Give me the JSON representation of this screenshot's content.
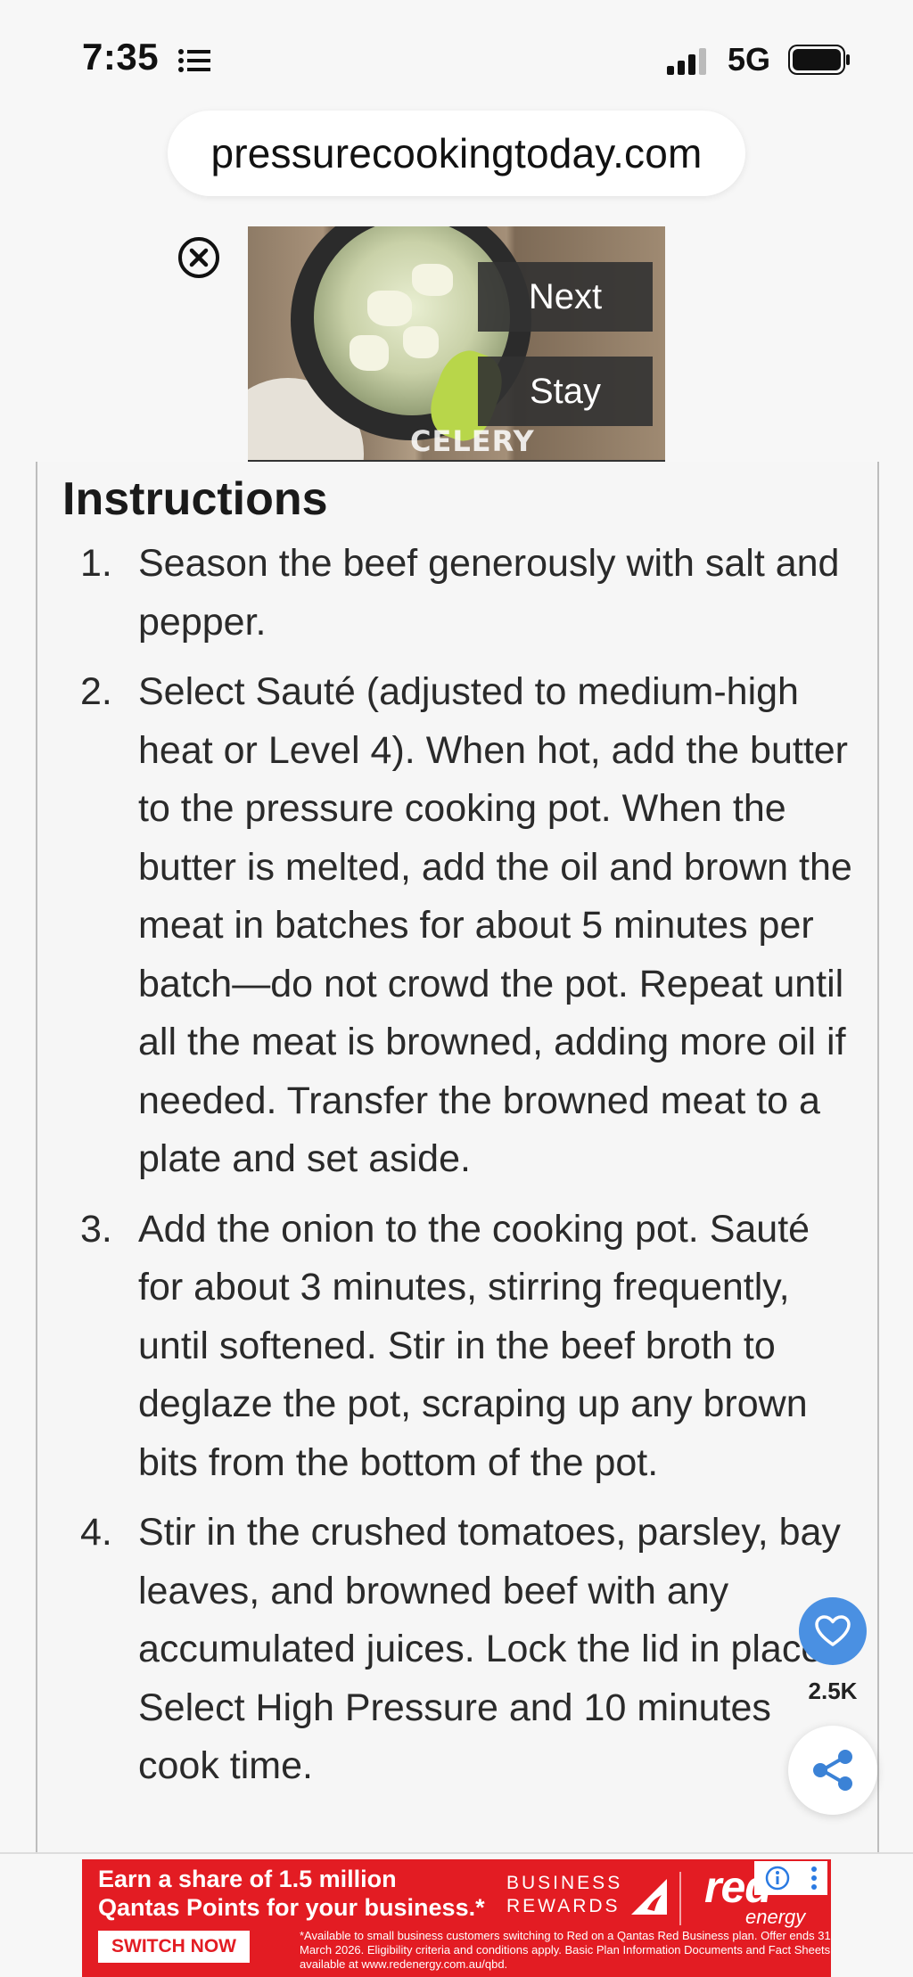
{
  "status_bar": {
    "time": "7:35",
    "network": "5G"
  },
  "browser": {
    "url": "pressurecookingtoday.com"
  },
  "video_ad": {
    "overlay_label": "CELERY",
    "next_label": "Next",
    "stay_label": "Stay"
  },
  "instructions": {
    "heading": "Instructions",
    "steps": [
      {
        "num": "1.",
        "text": "Season the beef generously with salt and pepper."
      },
      {
        "num": "2.",
        "text": "Select Sauté (adjusted to medium-high heat or Level 4). When hot, add the butter to the pressure cooking pot. When the butter is melted, add the oil and brown the meat in batches for about 5 minutes per batch—do not crowd the pot. Repeat until all the meat is browned, adding more oil if needed. Transfer the browned meat to a plate and set aside."
      },
      {
        "num": "3.",
        "text": "Add the onion to the cooking pot. Sauté for about 3 minutes, stirring frequently, until softened. Stir in the beef broth to deglaze the pot, scraping up any brown bits from the bottom of the pot."
      },
      {
        "num": "4.",
        "text": "Stir in the crushed tomatoes, parsley, bay leaves, and browned beef with any accumulated juices. Lock the lid in place. Select High Pressure and 10 minutes cook time."
      }
    ]
  },
  "floating": {
    "favorite_count": "2.5K",
    "heart_icon": "heart-icon",
    "share_icon": "share-icon"
  },
  "banner_ad": {
    "headline_1": "Earn a share of 1.5 million",
    "headline_2": "Qantas Points for your business.*",
    "cta": "SWITCH NOW",
    "rewards_1": "BUSINESS",
    "rewards_2": "REWARDS",
    "brand": "red",
    "brand_sub": "energy",
    "fine_print": "*Available to small business customers switching to Red on a Qantas Red Business plan. Offer ends 31 March 2026. Eligibility criteria and conditions apply. Basic Plan Information Documents and Fact Sheets available at www.redenergy.com.au/qbd."
  },
  "colors": {
    "ad_red": "#e31c23",
    "heart_blue": "#4a90e2",
    "share_blue": "#3b82d6"
  }
}
